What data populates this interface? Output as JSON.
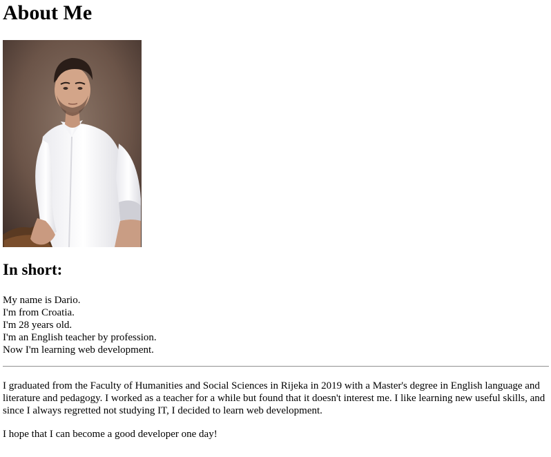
{
  "page": {
    "title": "About Me",
    "section_heading": "In short:",
    "facts": [
      "My name is Dario.",
      "I'm from Croatia.",
      "I'm 28 years old.",
      "I'm an English teacher by profession.",
      "Now I'm learning web development."
    ],
    "paragraphs": [
      "I graduated from the Faculty of Humanities and Social Sciences in Rijeka in 2019 with a Master's degree in English language and literature and pedagogy. I worked as a teacher for a while but found that it doesn't interest me. I like learning new useful skills, and since I always regretted not studying IT, I decided to learn web development.",
      "I hope that I can become a good developer one day!"
    ]
  }
}
